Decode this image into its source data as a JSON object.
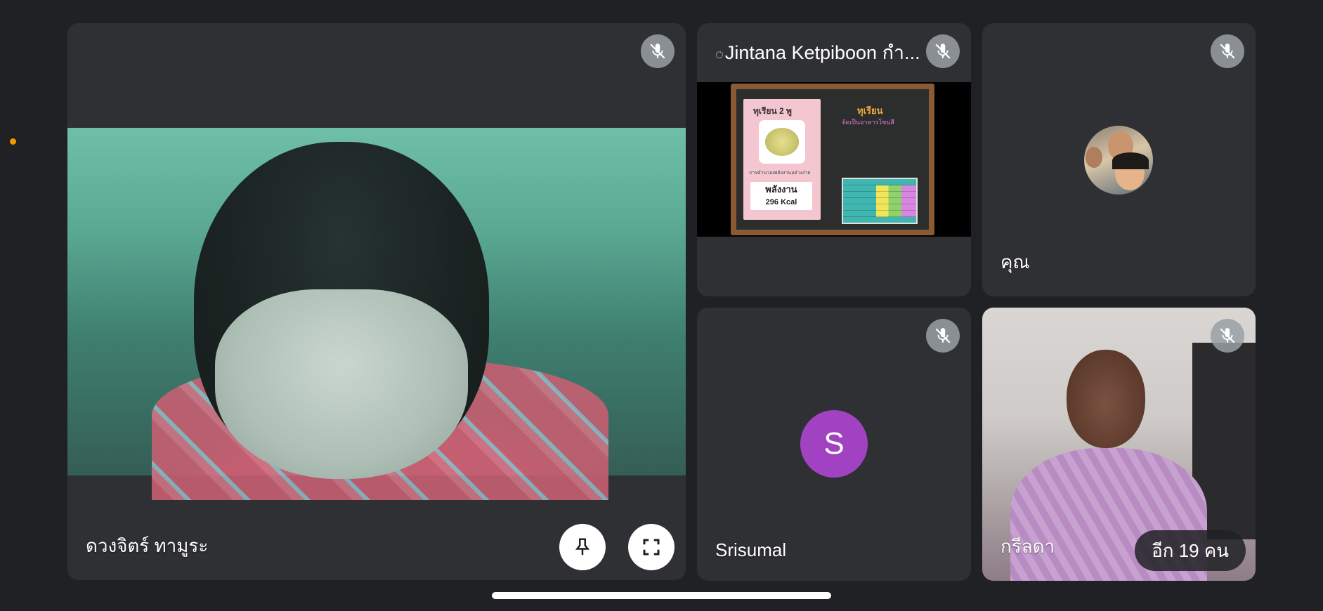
{
  "participants": {
    "main": {
      "name": "ดวงจิตร์ ทามูระ"
    },
    "presenter": {
      "title": "Jintana Ketpiboon กำ..."
    },
    "you": {
      "name": "คุณ"
    },
    "srisumal": {
      "name": "Srisumal",
      "initial": "S",
      "avatar_color": "#a142c3"
    },
    "kreelada": {
      "name": "กรีลดา"
    }
  },
  "more_participants": "อีก 19 คน",
  "shared_screen": {
    "card_title": "ทุเรียน 2 พู",
    "card_caption": "การคำนวณพลังงานอย่างง่าย",
    "energy_label": "พลังงาน",
    "energy_value": "296 Kcal",
    "board_title": "ทุเรียน",
    "board_subtitle": "จัดเป็นอาหารโซนสี"
  },
  "icons": {
    "mic_off": "mic-off-icon",
    "pin": "pin-icon",
    "fullscreen": "fullscreen-icon"
  }
}
